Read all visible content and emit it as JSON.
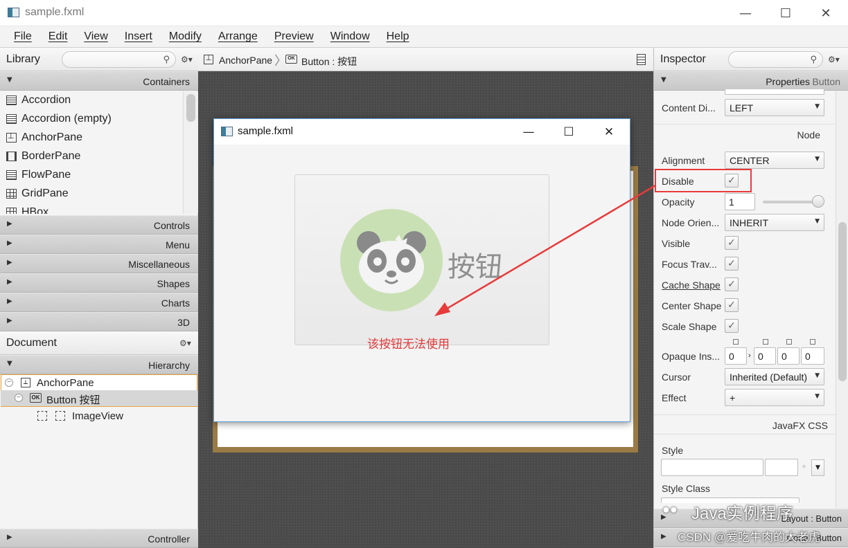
{
  "window": {
    "title": "sample.fxml",
    "minimize": "—",
    "maximize": "☐",
    "close": "✕"
  },
  "menu": [
    "File",
    "Edit",
    "View",
    "Insert",
    "Modify",
    "Arrange",
    "Preview",
    "Window",
    "Help"
  ],
  "library": {
    "title": "Library",
    "search_icon": "⚲",
    "gear": "⚙▾",
    "containers_label": "Containers",
    "items": [
      "Accordion",
      "Accordion  (empty)",
      "AnchorPane",
      "BorderPane",
      "FlowPane",
      "GridPane",
      "HBox"
    ],
    "sections": [
      "Controls",
      "Menu",
      "Miscellaneous",
      "Shapes",
      "Charts",
      "3D"
    ]
  },
  "document": {
    "title": "Document",
    "gear": "⚙▾",
    "hierarchy_label": "Hierarchy",
    "tree": [
      {
        "label": "AnchorPane",
        "icon": "⊥"
      },
      {
        "label": "Button  按钮",
        "icon": "OK"
      },
      {
        "label": "ImageView",
        "icon": ""
      }
    ],
    "controller_label": "Controller"
  },
  "breadcrumb": {
    "root": "AnchorPane",
    "child": "Button : 按钮"
  },
  "preview": {
    "title": "sample.fxml",
    "button_text": "按钮",
    "note": "该按钮无法使用"
  },
  "inspector": {
    "title": "Inspector",
    "properties_label": "Properties",
    "properties_target": " : Button",
    "content_display": {
      "label": "Content Di...",
      "value": "LEFT"
    },
    "node_label": "Node",
    "rows": {
      "alignment": {
        "label": "Alignment",
        "value": "CENTER"
      },
      "disable": {
        "label": "Disable",
        "checked": true
      },
      "opacity": {
        "label": "Opacity",
        "value": "1",
        "slider": 1.0
      },
      "node_orientation": {
        "label": "Node Orien...",
        "value": "INHERIT"
      },
      "visible": {
        "label": "Visible"
      },
      "focus_traversable": {
        "label": "Focus Trav..."
      },
      "cache_shape": {
        "label": "Cache Shape"
      },
      "center_shape": {
        "label": "Center Shape"
      },
      "scale_shape": {
        "label": "Scale Shape"
      },
      "opaque_insets": {
        "label": "Opaque Ins...",
        "values": [
          "0",
          "0",
          "0",
          "0"
        ]
      },
      "cursor": {
        "label": "Cursor",
        "value": "Inherited (Default)"
      },
      "effect": {
        "label": "Effect",
        "value": "+"
      }
    },
    "check_mark": "✓",
    "javafx_css_label": "JavaFX CSS",
    "style_label": "Style",
    "style_class_label": "Style Class",
    "layout_label": "Layout : Button",
    "code_label": "Code : Button"
  },
  "watermarks": {
    "account": "Java实例程序",
    "csdn": "CSDN @爱吃牛肉的大老虎"
  },
  "colors": {
    "annotation_red": "#e83a3a",
    "canvas": "#4a4a4a",
    "panda_circle": "#c9e0b4"
  }
}
